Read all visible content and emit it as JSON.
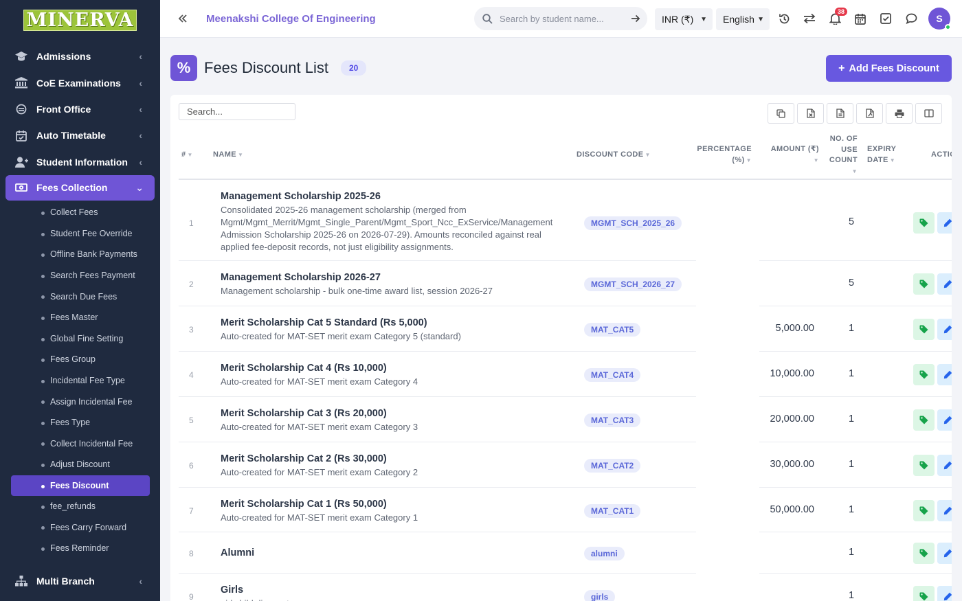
{
  "brand": {
    "logo_text": "MINERVA"
  },
  "sidebar": {
    "items": [
      {
        "label": "Admissions"
      },
      {
        "label": "CoE Examinations"
      },
      {
        "label": "Front Office"
      },
      {
        "label": "Auto Timetable"
      },
      {
        "label": "Student Information"
      },
      {
        "label": "Fees Collection"
      },
      {
        "label": "Multi Branch"
      }
    ],
    "fees_sub": [
      "Collect Fees",
      "Student Fee Override",
      "Offline Bank Payments",
      "Search Fees Payment",
      "Search Due Fees",
      "Fees Master",
      "Global Fine Setting",
      "Fees Group",
      "Incidental Fee Type",
      "Assign Incidental Fee",
      "Fees Type",
      "Collect Incidental Fee",
      "Adjust Discount",
      "Fees Discount",
      "fee_refunds",
      "Fees Carry Forward",
      "Fees Reminder"
    ]
  },
  "header": {
    "college_name": "Meenakshi College Of Engineering",
    "search_placeholder": "Search by student name...",
    "currency": "INR (₹)",
    "language": "English",
    "notification_count": "38",
    "avatar_initial": "S"
  },
  "page": {
    "title": "Fees Discount List",
    "count": "20",
    "add_button": "Add Fees Discount",
    "table_search_placeholder": "Search..."
  },
  "table": {
    "headers": {
      "num": "#",
      "name": "Name",
      "code": "Discount Code",
      "pct_1": "Percentage",
      "pct_2": "(%)",
      "amount": "Amount (₹)",
      "use_1": "No. of",
      "use_2": "Use",
      "use_3": "Count",
      "exp_1": "Expiry",
      "exp_2": "Date",
      "action": "Action"
    },
    "rows": [
      {
        "num": "1",
        "name": "Management Scholarship 2025-26",
        "desc": "Consolidated 2025-26 management scholarship (merged from Mgmt/Mgmt_Merrit/Mgmt_Single_Parent/Mgmt_Sport_Ncc_ExService/Management Admission Scholarship 2025-26 on 2026-07-29). Amounts reconciled against real applied fee-deposit records, not just eligibility assignments.",
        "code": "MGMT_SCH_2025_26",
        "amount": "",
        "uses": "5"
      },
      {
        "num": "2",
        "name": "Management Scholarship 2026-27",
        "desc": "Management scholarship - bulk one-time award list, session 2026-27",
        "code": "MGMT_SCH_2026_27",
        "amount": "",
        "uses": "5"
      },
      {
        "num": "3",
        "name": "Merit Scholarship Cat 5 Standard (Rs 5,000)",
        "desc": "Auto-created for MAT-SET merit exam Category 5 (standard)",
        "code": "MAT_CAT5",
        "amount": "5,000.00",
        "uses": "1"
      },
      {
        "num": "4",
        "name": "Merit Scholarship Cat 4 (Rs 10,000)",
        "desc": "Auto-created for MAT-SET merit exam Category 4",
        "code": "MAT_CAT4",
        "amount": "10,000.00",
        "uses": "1"
      },
      {
        "num": "5",
        "name": "Merit Scholarship Cat 3 (Rs 20,000)",
        "desc": "Auto-created for MAT-SET merit exam Category 3",
        "code": "MAT_CAT3",
        "amount": "20,000.00",
        "uses": "1"
      },
      {
        "num": "6",
        "name": "Merit Scholarship Cat 2 (Rs 30,000)",
        "desc": "Auto-created for MAT-SET merit exam Category 2",
        "code": "MAT_CAT2",
        "amount": "30,000.00",
        "uses": "1"
      },
      {
        "num": "7",
        "name": "Merit Scholarship Cat 1 (Rs 50,000)",
        "desc": "Auto-created for MAT-SET merit exam Category 1",
        "code": "MAT_CAT1",
        "amount": "50,000.00",
        "uses": "1"
      },
      {
        "num": "8",
        "name": "Alumni",
        "desc": "",
        "code": "alumni",
        "amount": "",
        "uses": "1"
      },
      {
        "num": "9",
        "name": "Girls",
        "desc": "girl child discount",
        "code": "girls",
        "amount": "",
        "uses": "1"
      }
    ]
  },
  "colors": {
    "accent": "#6f55d6",
    "sidebar_bg": "#1f2a3f",
    "button": "#6858e0"
  }
}
